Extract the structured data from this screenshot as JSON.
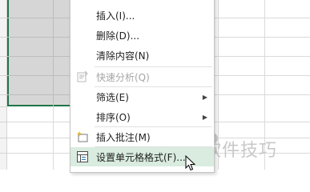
{
  "menu": {
    "items": [
      {
        "label": "插入(I)...",
        "icon": "none",
        "disabled": false,
        "submenu": false
      },
      {
        "label": "删除(D)...",
        "icon": "none",
        "disabled": false,
        "submenu": false
      },
      {
        "label": "清除内容(N)",
        "icon": "none",
        "disabled": false,
        "submenu": false
      },
      {
        "label": "快速分析(Q)",
        "icon": "quick-analysis-icon",
        "disabled": true,
        "submenu": false
      },
      {
        "label": "筛选(E)",
        "icon": "none",
        "disabled": false,
        "submenu": true
      },
      {
        "label": "排序(O)",
        "icon": "none",
        "disabled": false,
        "submenu": true
      },
      {
        "label": "插入批注(M)",
        "icon": "insert-comment-icon",
        "disabled": false,
        "submenu": false
      },
      {
        "label": "设置单元格格式(F)...",
        "icon": "format-cells-icon",
        "disabled": false,
        "submenu": false,
        "hovered": true
      }
    ],
    "submenu_arrow": "▶"
  },
  "watermark": {
    "text": "软件技巧"
  },
  "colors": {
    "selection_border": "#217346",
    "selection_fill": "#d6d6d6",
    "hover_fill": "#d9ecdf",
    "disabled_text": "#a6a6a6"
  }
}
